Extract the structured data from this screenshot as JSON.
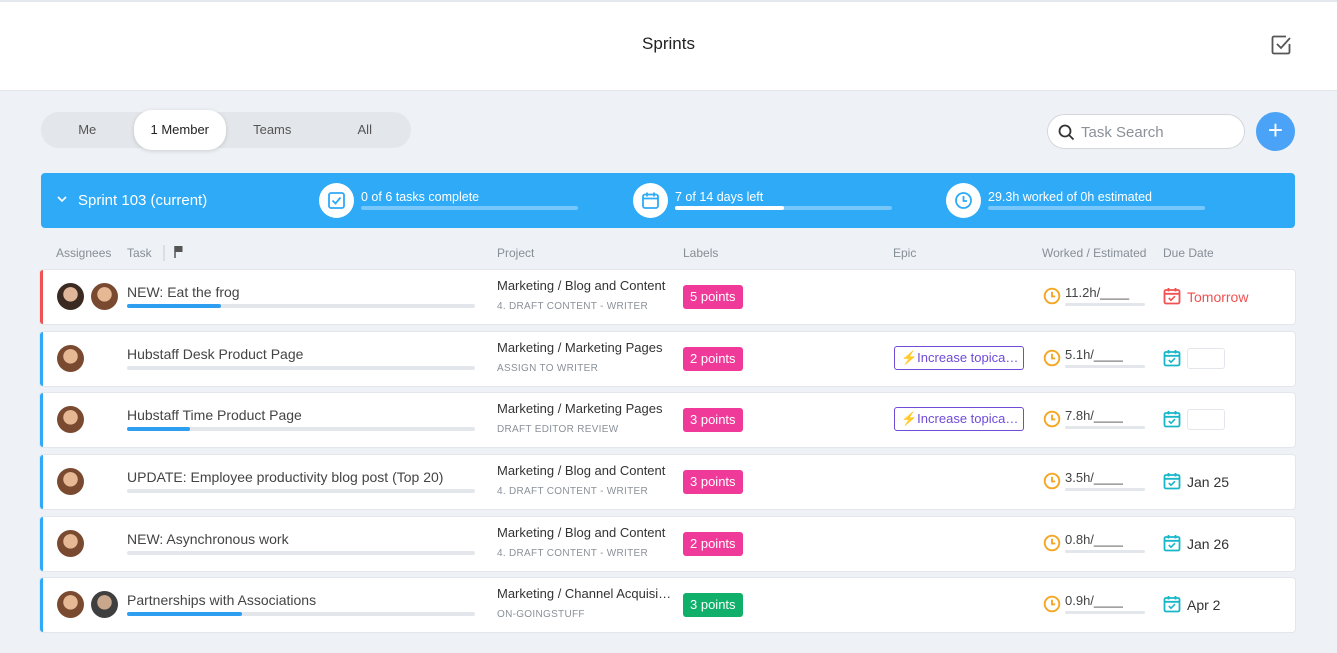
{
  "header": {
    "title": "Sprints",
    "icon": "check-square-icon"
  },
  "filters": {
    "tabs": [
      "Me",
      "1 Member",
      "Teams",
      "All"
    ],
    "active": "1 Member"
  },
  "search": {
    "placeholder": "Task Search"
  },
  "add_button": {
    "label": "+"
  },
  "sprint": {
    "name": "Sprint 103 (current)",
    "stats": [
      {
        "icon": "check-square-icon",
        "text": "0 of 6 tasks complete",
        "progress": 0.0
      },
      {
        "icon": "calendar-icon",
        "text": "7 of 14 days left",
        "progress": 0.5
      },
      {
        "icon": "clock-icon",
        "text": "29.3h worked of 0h estimated",
        "progress": 0.0
      }
    ]
  },
  "columns": {
    "assignees": "Assignees",
    "task": "Task",
    "project": "Project",
    "labels": "Labels",
    "epic": "Epic",
    "worked": "Worked / Estimated",
    "due": "Due Date"
  },
  "colors": {
    "accent": "#2eaaf7",
    "label_pink": "#ef3a9a",
    "label_green": "#10b06a",
    "epic_purple": "#6f4bd8",
    "overdue_red": "#f05151",
    "clock_orange": "#f5a623",
    "cal_teal": "#18b6c9"
  },
  "tasks": [
    {
      "name": "NEW: Eat the frog",
      "progress": 0.27,
      "project": "Marketing / Blog and Content",
      "stage": "4. DRAFT CONTENT - WRITER",
      "label": "5 points",
      "epic": "",
      "worked": "11.2h/____",
      "due": "Tomorrow"
    },
    {
      "name": "Hubstaff Desk Product Page",
      "progress": 0.0,
      "project": "Marketing / Marketing Pages",
      "stage": "ASSIGN TO WRITER",
      "label": "2 points",
      "epic": "⚡Increase topica…",
      "worked": "5.1h/____",
      "due": ""
    },
    {
      "name": "Hubstaff Time Product Page",
      "progress": 0.18,
      "project": "Marketing / Marketing Pages",
      "stage": "DRAFT EDITOR REVIEW",
      "label": "3 points",
      "epic": "⚡Increase topica…",
      "worked": "7.8h/____",
      "due": ""
    },
    {
      "name": "UPDATE: Employee productivity blog post (Top 20)",
      "progress": 0.0,
      "project": "Marketing / Blog and Content",
      "stage": "4. DRAFT CONTENT - WRITER",
      "label": "3 points",
      "epic": "",
      "worked": "3.5h/____",
      "due": "Jan 25"
    },
    {
      "name": "NEW: Asynchronous work",
      "progress": 0.0,
      "project": "Marketing / Blog and Content",
      "stage": "4. DRAFT CONTENT - WRITER",
      "label": "2 points",
      "epic": "",
      "worked": "0.8h/____",
      "due": "Jan 26"
    },
    {
      "name": "Partnerships with Associations",
      "progress": 0.33,
      "project": "Marketing / Channel Acquisi…",
      "stage": "ON-GOINGSTUFF",
      "label": "3 points",
      "epic": "",
      "worked": "0.9h/____",
      "due": "Apr 2"
    }
  ]
}
